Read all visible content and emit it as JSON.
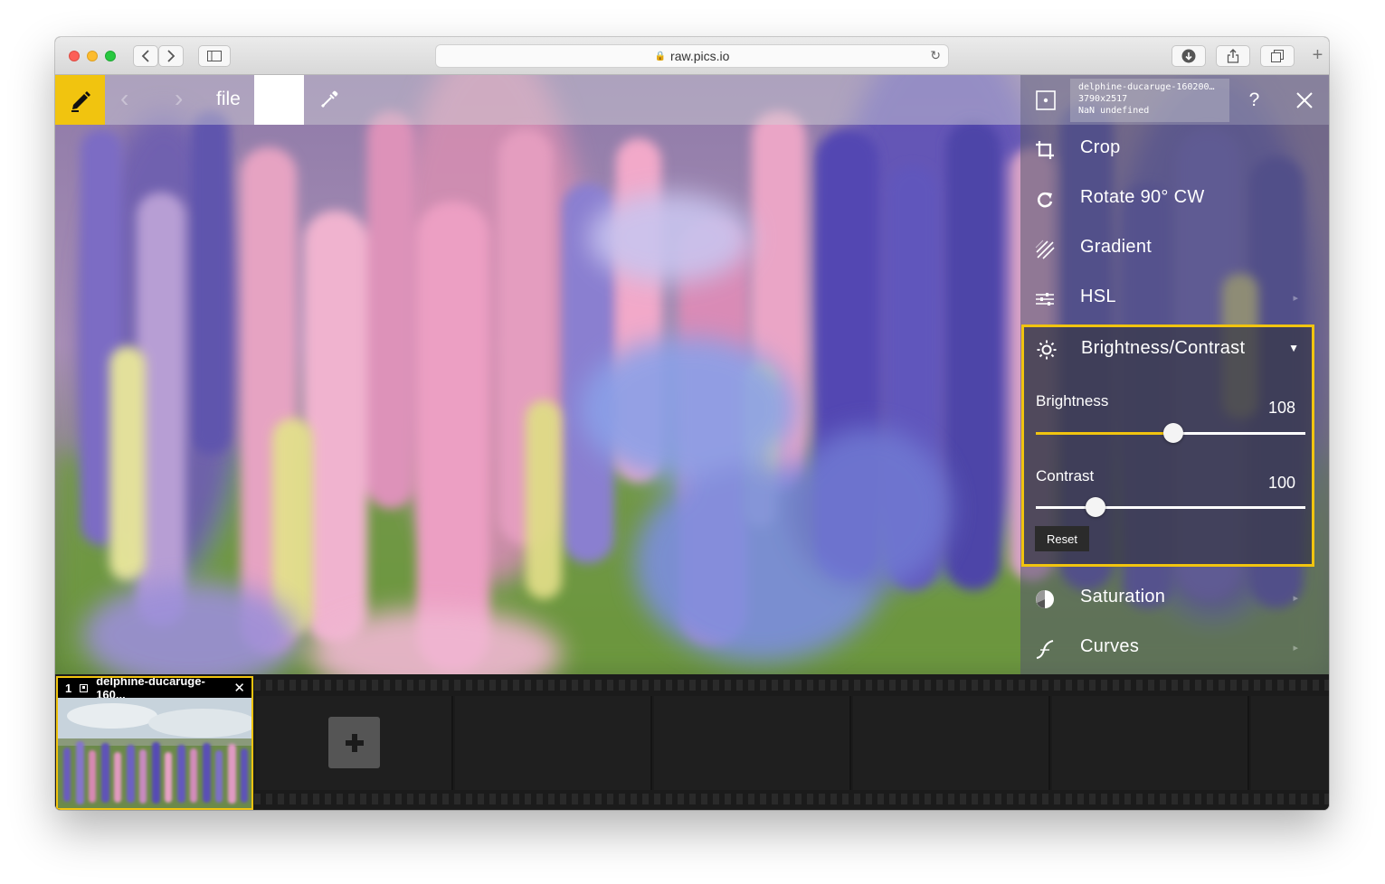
{
  "browser": {
    "url": "raw.pics.io",
    "back_icon": "chevron-left-icon",
    "forward_icon": "chevron-right-icon"
  },
  "toolbar": {
    "file_label": "file"
  },
  "image_info": {
    "filename": "delphine-ducaruge-160200…",
    "dimensions": "3790x2517",
    "extra": "NaN undefined"
  },
  "panel": {
    "help_label": "?",
    "tools": [
      {
        "label": "Crop",
        "icon": "crop-icon"
      },
      {
        "label": "Rotate 90° CW",
        "icon": "rotate-cw-icon"
      },
      {
        "label": "Gradient",
        "icon": "gradient-icon"
      },
      {
        "label": "HSL",
        "icon": "hsl-icon"
      },
      {
        "label": "Brightness/Contrast",
        "icon": "sun-icon"
      },
      {
        "label": "Saturation",
        "icon": "saturation-icon"
      },
      {
        "label": "Curves",
        "icon": "curves-icon"
      }
    ],
    "brightness_contrast": {
      "brightness_label": "Brightness",
      "brightness_value": "108",
      "brightness_level": 0.51,
      "contrast_label": "Contrast",
      "contrast_value": "100",
      "contrast_level": 0.22,
      "reset_label": "Reset"
    }
  },
  "filmstrip": {
    "thumb_index": "1",
    "thumb_name": "delphine-ducaruge-160...",
    "add_label": "+"
  },
  "colors": {
    "accent": "#f1c40f"
  }
}
